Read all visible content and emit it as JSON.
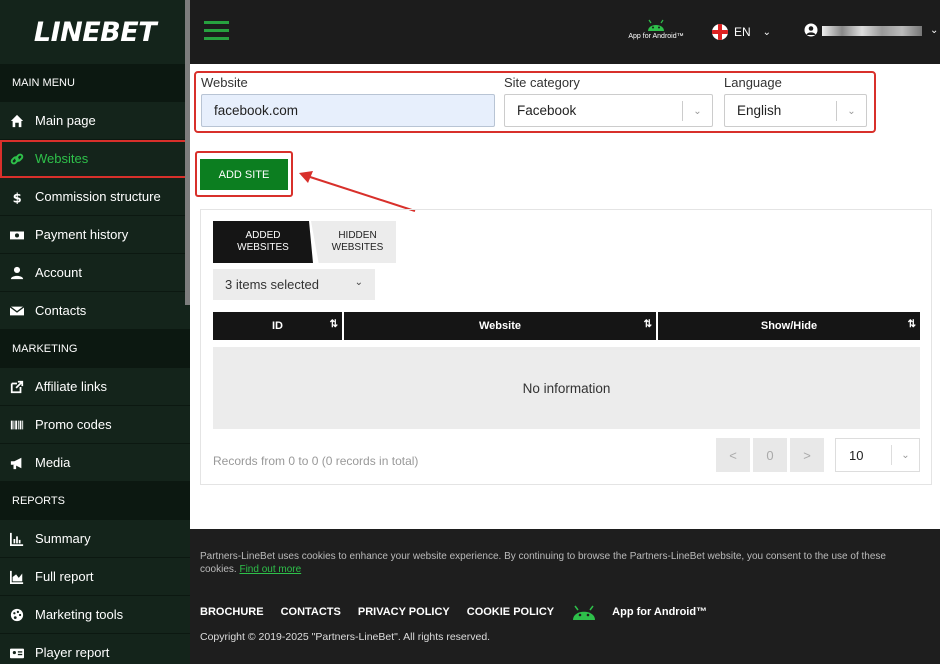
{
  "brand": {
    "logo": "LINEBET"
  },
  "sidebar": {
    "sections": [
      {
        "title": "MAIN MENU",
        "items": [
          {
            "label": "Main page",
            "icon": "home-icon"
          },
          {
            "label": "Websites",
            "icon": "link-icon",
            "active": true
          },
          {
            "label": "Commission structure",
            "icon": "dollar-icon"
          },
          {
            "label": "Payment history",
            "icon": "money-icon"
          },
          {
            "label": "Account",
            "icon": "user-icon"
          },
          {
            "label": "Contacts",
            "icon": "envelope-icon"
          }
        ]
      },
      {
        "title": "MARKETING",
        "items": [
          {
            "label": "Affiliate links",
            "icon": "external-link-icon"
          },
          {
            "label": "Promo codes",
            "icon": "barcode-icon"
          },
          {
            "label": "Media",
            "icon": "megaphone-icon"
          }
        ]
      },
      {
        "title": "REPORTS",
        "items": [
          {
            "label": "Summary",
            "icon": "bar-chart-icon"
          },
          {
            "label": "Full report",
            "icon": "area-chart-icon"
          },
          {
            "label": "Marketing tools",
            "icon": "palette-icon"
          },
          {
            "label": "Player report",
            "icon": "id-card-icon"
          }
        ]
      }
    ]
  },
  "topbar": {
    "android_label": "App for Android™",
    "language": "EN",
    "accent_color": "#27a13f"
  },
  "form": {
    "website_label": "Website",
    "website_value": "facebook.com",
    "category_label": "Site category",
    "category_value": "Facebook",
    "language_label": "Language",
    "language_value": "English",
    "add_button": "ADD SITE"
  },
  "panel": {
    "tab_added": "ADDED WEBSITES",
    "tab_hidden": "HIDDEN WEBSITES",
    "items_selected": "3 items selected",
    "columns": [
      "ID",
      "Website",
      "Show/Hide"
    ],
    "empty_text": "No information",
    "records_text": "Records from 0 to 0 (0 records in total)",
    "pagination": {
      "prev": "<",
      "page": "0",
      "next": ">"
    },
    "per_page": "10"
  },
  "footer": {
    "cookie_text": "Partners-LineBet uses cookies to enhance your website experience. By continuing to browse the Partners-LineBet website, you consent to the use of these cookies.",
    "cookie_link": "Find out more",
    "links": [
      "BROCHURE",
      "CONTACTS",
      "PRIVACY POLICY",
      "COOKIE POLICY"
    ],
    "android_label": "App for Android™",
    "copyright": "Copyright © 2019-2025 \"Partners-LineBet\". All rights reserved."
  },
  "colors": {
    "sidebar_bg": "#14241b",
    "active_green": "#2ec04a",
    "button_green": "#0c7e20",
    "highlight_red": "#d8302b"
  }
}
